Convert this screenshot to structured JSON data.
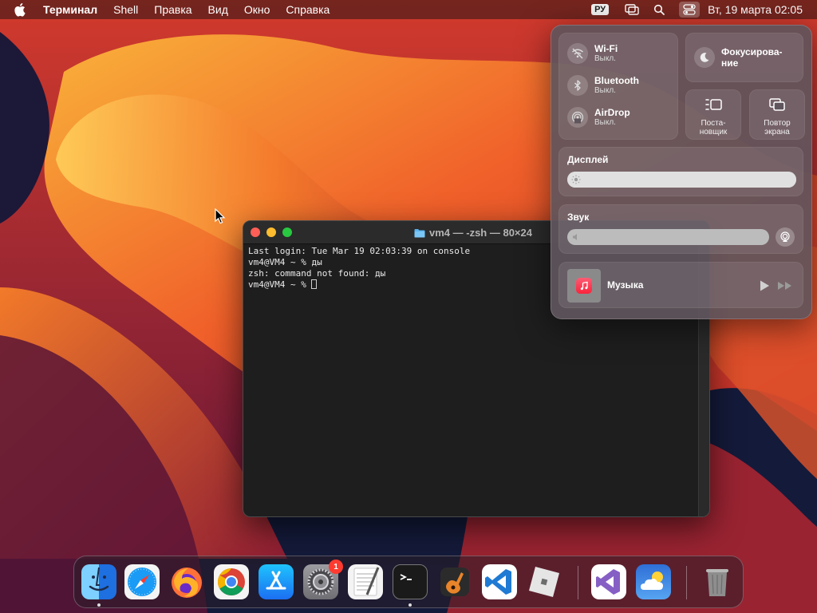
{
  "menubar": {
    "app_name": "Терминал",
    "items": [
      "Shell",
      "Правка",
      "Вид",
      "Окно",
      "Справка"
    ],
    "input_language": "РУ",
    "datetime": "Вт, 19 марта  02:05"
  },
  "terminal": {
    "title": "vm4 — -zsh — 80×24",
    "lines": [
      "Last login: Tue Mar 19 02:03:39 on console",
      "vm4@VM4 ~ % ды",
      "zsh: command not found: ды",
      "vm4@VM4 ~ % "
    ]
  },
  "control_center": {
    "wifi": {
      "name": "Wi-Fi",
      "status": "Выкл."
    },
    "bluetooth": {
      "name": "Bluetooth",
      "status": "Выкл."
    },
    "airdrop": {
      "name": "AirDrop",
      "status": "Выкл."
    },
    "focus": {
      "label": "Фокусирова-\nние"
    },
    "stage_manager": {
      "label": "Поста-\nновщик"
    },
    "screen_mirroring": {
      "label": "Повтор\nэкрана"
    },
    "display": {
      "title": "Дисплей",
      "brightness": 1.0
    },
    "sound": {
      "title": "Звук",
      "volume": 0.0
    },
    "now_playing": {
      "label": "Музыка"
    }
  },
  "dock": {
    "apps": [
      {
        "name": "finder-icon",
        "running": true,
        "color": "#1e8cf0"
      },
      {
        "name": "safari-icon",
        "running": false,
        "color": "#1a9bf5"
      },
      {
        "name": "firefox-icon",
        "running": false,
        "color": "#ff7139"
      },
      {
        "name": "chrome-icon",
        "running": false,
        "color": "#db4437"
      },
      {
        "name": "app-store-icon",
        "running": false,
        "color": "#1c8cf4"
      },
      {
        "name": "system-settings-icon",
        "running": false,
        "color": "#8e8e93",
        "badge": "1"
      },
      {
        "name": "textedit-icon",
        "running": false,
        "color": "#f2f2f2"
      },
      {
        "name": "terminal-icon",
        "running": true,
        "color": "#1a1a1a"
      },
      {
        "name": "garageband-icon",
        "running": false,
        "color": "#e8842a"
      },
      {
        "name": "vscode-icon",
        "running": false,
        "color": "#1f7ad4"
      },
      {
        "name": "roblox-icon",
        "running": false,
        "color": "#e5e5e5"
      },
      {
        "name": "visual-studio-icon",
        "running": false,
        "color": "#865fc5"
      },
      {
        "name": "weather-icon",
        "running": false,
        "color": "#3a86e8"
      },
      {
        "name": "trash-icon",
        "running": false,
        "color": "#9a9a9a"
      }
    ]
  }
}
